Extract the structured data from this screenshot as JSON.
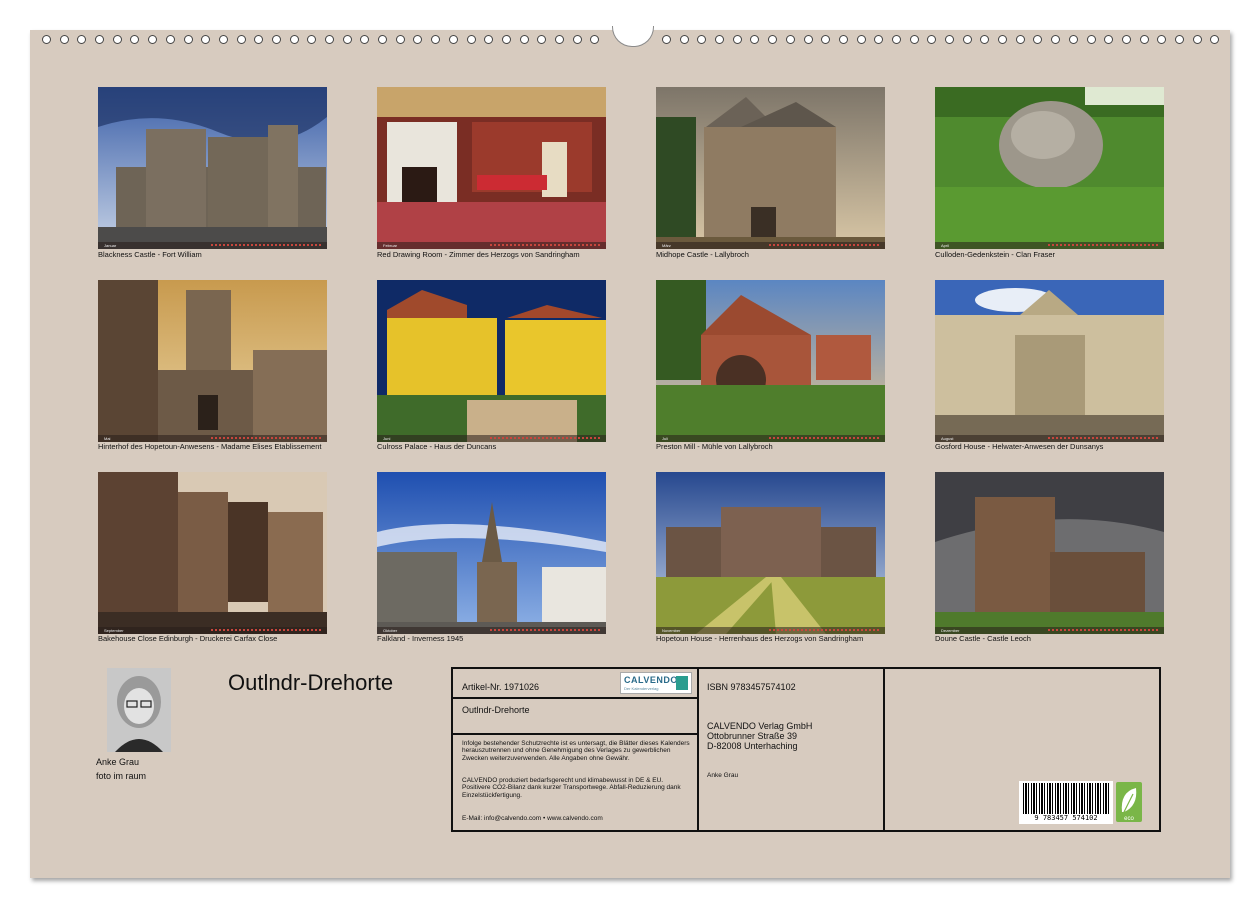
{
  "calendar": {
    "title": "Outlndr-Drehorte"
  },
  "tiles": [
    {
      "caption": "Blackness Castle - Fort William",
      "month": "Januar"
    },
    {
      "caption": "Red Drawing Room - Zimmer des Herzogs von Sandringham",
      "month": "Februar"
    },
    {
      "caption": "Midhope Castle - Lallybroch",
      "month": "März"
    },
    {
      "caption": "Culloden-Gedenkstein - Clan Fraser",
      "month": "April"
    },
    {
      "caption": "Hinterhof des Hopetoun-Anwesens - Madame Elises Etablissement",
      "month": "Mai"
    },
    {
      "caption": "Culross Palace - Haus der Duncans",
      "month": "Juni"
    },
    {
      "caption": "Preston Mill - Mühle von Lallybroch",
      "month": "Juli"
    },
    {
      "caption": "Gosford House - Helwater-Anwesen der Dunsanys",
      "month": "August"
    },
    {
      "caption": "Bakehouse Close Edinburgh -  Druckerei Carfax Close",
      "month": "September"
    },
    {
      "caption": "Falkland - Inverness 1945",
      "month": "Oktober"
    },
    {
      "caption": "Hopetoun House - Herrenhaus des Herzogs von Sandringham",
      "month": "November"
    },
    {
      "caption": "Doune Castle - Castle Leoch",
      "month": "Dezember"
    }
  ],
  "author": {
    "name": "Anke Grau",
    "tagline": "foto im raum"
  },
  "info": {
    "article": "Artikel-Nr. 1971026",
    "logo": "CALVENDO",
    "logo_sub": "Der Kalenderverlag",
    "title": "Outlndr-Drehorte",
    "legal1": "Infolge bestehender Schutzrechte ist es untersagt, die Blätter dieses Kalenders herauszutrennen und ohne Genehmigung des Verlages zu gewerblichen Zwecken weiterzuverwenden. Alle Angaben ohne Gewähr.",
    "legal2": "CALVENDO produziert bedarfsgerecht und klimabewusst in DE & EU. Positivere CO2-Bilanz dank kurzer Transportwege. Abfall-Reduzierung dank Einzelstückfertigung.",
    "contact": "E-Mail: info@calvendo.com • www.calvendo.com",
    "isbn": "ISBN 9783457574102",
    "publisher": "CALVENDO Verlag GmbH",
    "street": "Ottobrunner Straße 39",
    "city": "D-82008 Unterhaching",
    "author_small": "Anke Grau",
    "barcode_number": "9 783457 574102",
    "eco_label": "eco"
  }
}
